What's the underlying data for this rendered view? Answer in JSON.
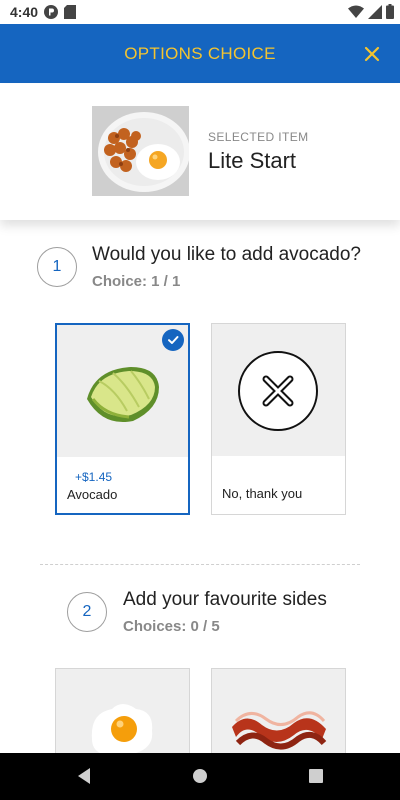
{
  "status_bar": {
    "time": "4:40"
  },
  "header": {
    "title": "OPTIONS CHOICE"
  },
  "selected_item": {
    "label": "SELECTED ITEM",
    "name": "Lite Start"
  },
  "sections": [
    {
      "number": "1",
      "title": "Would you like to add avocado?",
      "subtitle": "Choice: 1 / 1",
      "options": [
        {
          "price": "+$1.45",
          "label": "Avocado",
          "selected": true
        },
        {
          "price": "",
          "label": "No, thank you",
          "selected": false
        }
      ]
    },
    {
      "number": "2",
      "title": "Add your favourite sides",
      "subtitle": "Choices: 0 / 5"
    }
  ],
  "colors": {
    "accent": "#1565c0",
    "header_text": "#f4c430"
  }
}
